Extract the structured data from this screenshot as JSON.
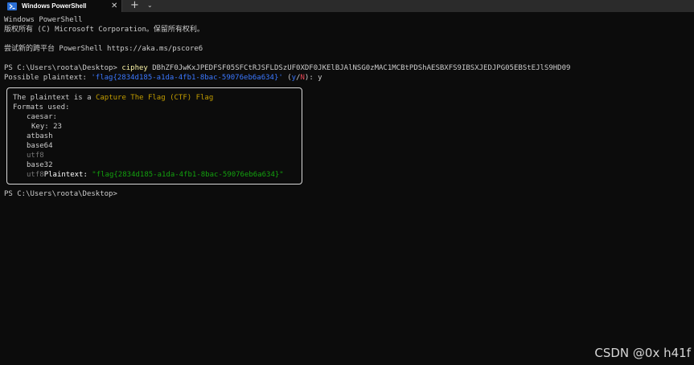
{
  "window": {
    "tab_title": "Windows PowerShell",
    "close_glyph": "✕",
    "new_tab_glyph": "+",
    "dropdown_glyph": "⌄"
  },
  "terminal": {
    "banner_1": "Windows PowerShell",
    "banner_2": "版权所有 (C) Microsoft Corporation。保留所有权利。",
    "banner_3": "尝试新的跨平台 PowerShell https://aka.ms/pscore6",
    "prompt": "PS C:\\Users\\roota\\Desktop> ",
    "command": "ciphey",
    "argument": " DBhZF0JwKxJPEDFSF05SFCtRJSFLDSzUF0XDF0JKElBJAlNSG0zMAC1MCBtPDShAESBXFS9IBSXJEDJPG05EBStEJlS9HD09",
    "possible_label": "Possible plaintext: ",
    "possible_value": "'flag{2834d185-a1da-4fb1-8bac-59076eb6a634}'",
    "confirm_open": " (",
    "confirm_y": "y",
    "confirm_slash": "/",
    "confirm_n": "N",
    "confirm_close": "): ",
    "answer": "y",
    "result": {
      "plaintext_prefix": "The plaintext is a ",
      "plaintext_type": "Capture The Flag (CTF) Flag",
      "formats_label": "Formats used:",
      "formats": [
        "caesar:",
        "Key: 23",
        "atbash",
        "base64",
        "utf8",
        "base32"
      ],
      "last_format": "utf8",
      "plaintext_label": "Plaintext: ",
      "plaintext_value": "\"flag{2834d185-a1da-4fb1-8bac-59076eb6a634}\""
    },
    "final_prompt": "PS C:\\Users\\roota\\Desktop>"
  },
  "watermark": "CSDN @0x h41f",
  "colors": {
    "background": "#0c0c0c",
    "text": "#cccccc",
    "command": "#f9f1a5",
    "blue": "#3b78ff",
    "yellow": "#c19c00",
    "green": "#13a10e",
    "gray": "#767676"
  }
}
